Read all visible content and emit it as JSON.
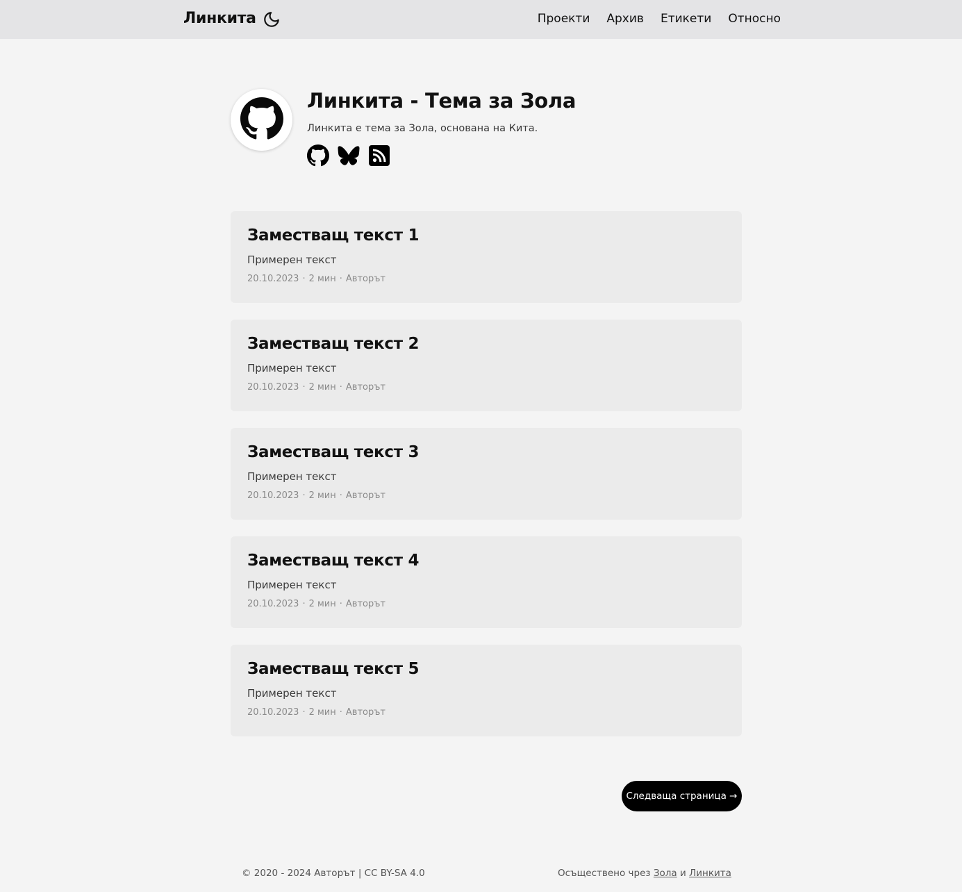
{
  "header": {
    "brand": "Линкита",
    "nav": [
      "Проекти",
      "Архив",
      "Етикети",
      "Относно"
    ]
  },
  "profile": {
    "title": "Линкита - Тема за Зола",
    "subtitle": "Линкита е тема за Зола, основана на Кита.",
    "socials": [
      "github-icon",
      "bluesky-icon",
      "rss-icon"
    ]
  },
  "posts": [
    {
      "title": "Заместващ текст 1",
      "summary": "Примерен текст",
      "date": "20.10.2023",
      "reading": "2 мин",
      "author": "Авторът"
    },
    {
      "title": "Заместващ текст 2",
      "summary": "Примерен текст",
      "date": "20.10.2023",
      "reading": "2 мин",
      "author": "Авторът"
    },
    {
      "title": "Заместващ текст 3",
      "summary": "Примерен текст",
      "date": "20.10.2023",
      "reading": "2 мин",
      "author": "Авторът"
    },
    {
      "title": "Заместващ текст 4",
      "summary": "Примерен текст",
      "date": "20.10.2023",
      "reading": "2 мин",
      "author": "Авторът"
    },
    {
      "title": "Заместващ текст 5",
      "summary": "Примерен текст",
      "date": "20.10.2023",
      "reading": "2 мин",
      "author": "Авторът"
    }
  ],
  "meta_separator": "·",
  "pagination": {
    "next_label": "Следваща страница →"
  },
  "footer": {
    "copyright": "© 2020 - 2024 Авторът | CC BY-SA 4.0",
    "powered_prefix": "Осъществено чрез",
    "powered_link1": "Зола",
    "powered_and": "и",
    "powered_link2": "Линкита"
  }
}
